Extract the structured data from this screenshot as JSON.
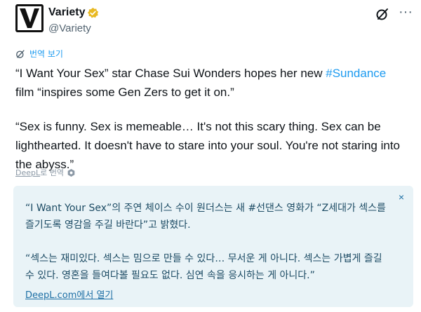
{
  "author": {
    "name": "Variety",
    "handle": "@Variety",
    "avatar_letter": "V",
    "verified_color": "#e8b923"
  },
  "actions": {
    "grok_icon": "grok-icon",
    "more_label": "···"
  },
  "translate": {
    "label": "번역 보기"
  },
  "tweet": {
    "line1_prefix": "“I Want Your Sex” star Chase Sui Wonders hopes her new ",
    "hashtag": "#Sundance",
    "line1_suffix": "film “inspires some Gen Zers to get it on.”",
    "quote": "“Sex is funny. Sex is memeable… It's not this scary thing. Sex can be lighthearted. It doesn't have to stare into your soul. You're not staring into the abyss.”"
  },
  "deepl_credit": {
    "label_underlined": "DeepL",
    "label_rest": "로 번역"
  },
  "translation_box": {
    "close_label": "×",
    "para1": "“I Want Your Sex”의 주연 체이스 수이 원더스는 새 #선댄스 영화가 “Z세대가 섹스를 즐기도록 영감을 주길 바란다”고 밝혔다.",
    "para2": "“섹스는 재미있다. 섹스는 밈으로 만들 수 있다… 무서운 게 아니다. 섹스는 가볍게 즐길 수 있다. 영혼을 들여다볼 필요도 없다. 심연 속을 응시하는 게 아니다.”",
    "link_label": "DeepL.com에서 열기"
  },
  "colors": {
    "accent": "#1d9bf0",
    "box_bg": "#e9f3f7",
    "box_text": "#1b4a63"
  }
}
